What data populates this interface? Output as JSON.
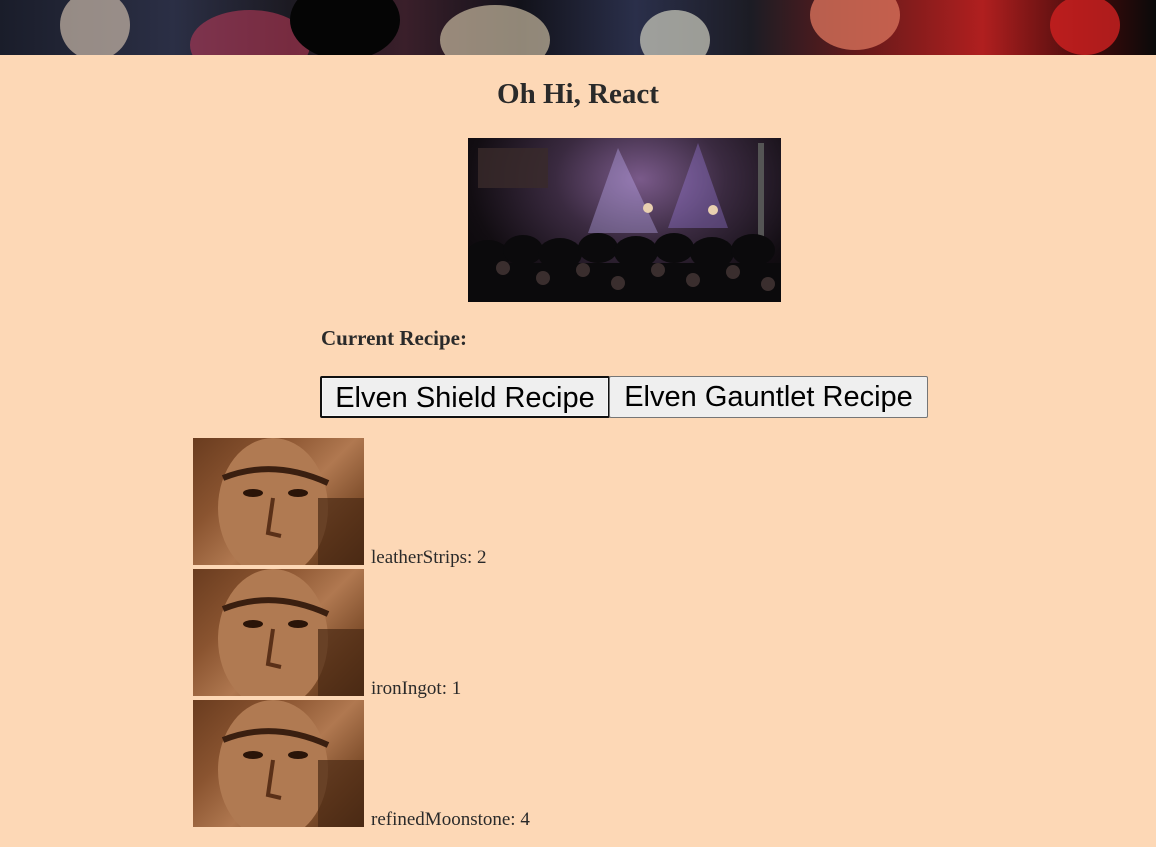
{
  "header": {
    "banner_image": "crowd-banner-photo",
    "title": "Oh Hi, React",
    "hero_image": "concert-crowd-photo"
  },
  "recipe": {
    "current_label": "Current Recipe:",
    "buttons": [
      {
        "label": "Elven Shield Recipe",
        "focused": true
      },
      {
        "label": "Elven Gauntlet Recipe",
        "focused": false
      }
    ]
  },
  "ingredients": [
    {
      "text": "leatherStrips: 2",
      "image": "man-portrait-photo"
    },
    {
      "text": "ironIngot: 1",
      "image": "man-portrait-photo"
    },
    {
      "text": "refinedMoonstone: 4",
      "image": "man-portrait-photo"
    }
  ],
  "colors": {
    "page_background": "#fdd8b6",
    "text": "#2a2a2a",
    "button_background": "#efefef"
  }
}
